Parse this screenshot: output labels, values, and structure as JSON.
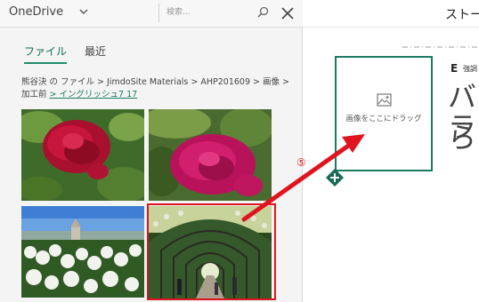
{
  "header": {
    "app_name": "OneDrive",
    "search_placeholder": "検索..."
  },
  "tabs": [
    {
      "label": "ファイル",
      "selected": true
    },
    {
      "label": "最近",
      "selected": false
    }
  ],
  "breadcrumb": {
    "path": "熊谷決 の ファイル > JimdoSite Materials > AHP201609 > 画像 > 加工前 ",
    "current": "> イングリッシュ7 17"
  },
  "photos": [
    {
      "icon": "red-rose-photo"
    },
    {
      "icon": "pink-rose-photo"
    },
    {
      "icon": "white-rose-garden-photo"
    },
    {
      "icon": "rose-arch-tunnel-photo"
    }
  ],
  "editor": {
    "title": "ストー",
    "drop_hint": "画像をここにドラッグ",
    "emphasis_glyph": "E",
    "emphasis_label": "強調",
    "large_text_line1": "バラ",
    "large_text_line2": "ら"
  },
  "annotation": {
    "step": "⑤",
    "color": "#e0141e"
  },
  "colors": {
    "accent": "#1d8c6a",
    "highlight": "#e0141e"
  }
}
